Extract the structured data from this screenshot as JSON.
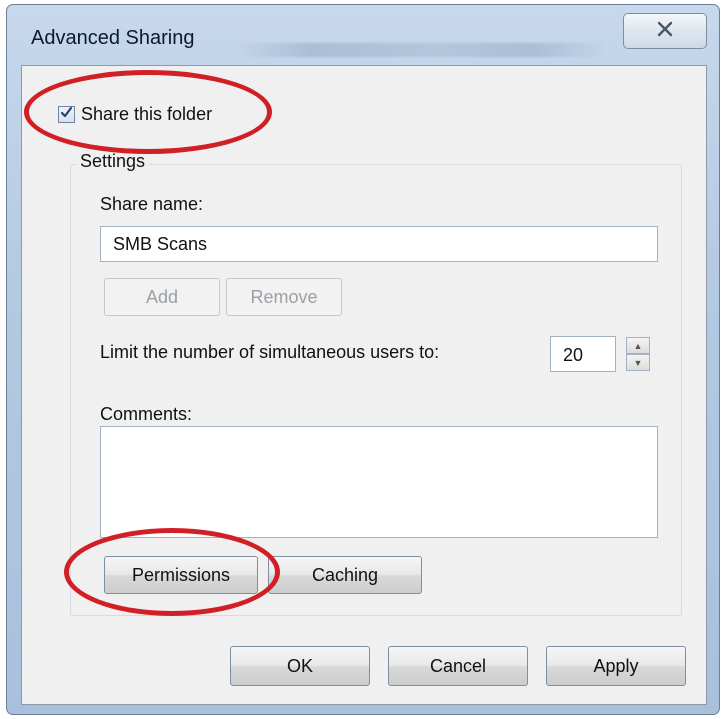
{
  "window": {
    "title": "Advanced Sharing"
  },
  "share": {
    "checkbox_label": "Share this folder",
    "checked": true
  },
  "settings": {
    "legend": "Settings",
    "share_name_label": "Share name:",
    "share_name_value": "SMB Scans",
    "add_label": "Add",
    "remove_label": "Remove",
    "limit_label": "Limit the number of simultaneous users to:",
    "limit_value": "20",
    "comments_label": "Comments:",
    "comments_value": "",
    "permissions_label": "Permissions",
    "caching_label": "Caching"
  },
  "footer": {
    "ok_label": "OK",
    "cancel_label": "Cancel",
    "apply_label": "Apply"
  },
  "icons": {
    "close": "close-icon",
    "check": "checkmark-icon",
    "spin_up": "spin-up-icon",
    "spin_down": "spin-down-icon"
  },
  "colors": {
    "highlight_ellipse": "#d11f26",
    "title_bar": "#b4c9e2",
    "client_bg": "#f0f0f0"
  }
}
